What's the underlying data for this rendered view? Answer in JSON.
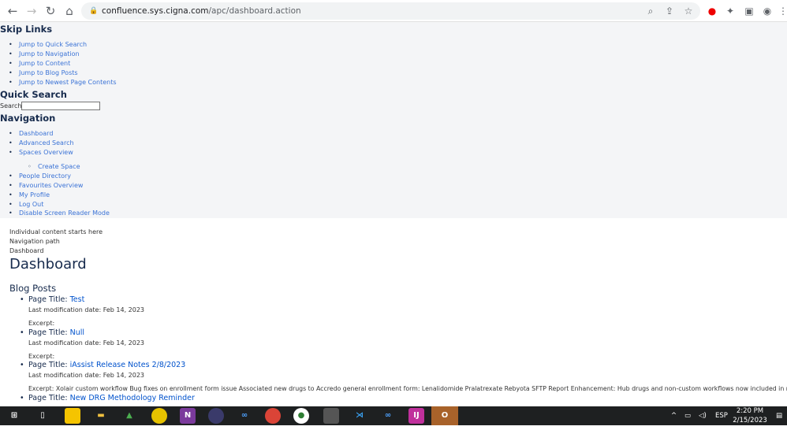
{
  "browser": {
    "url_host": "confluence.sys.cigna.com",
    "url_path": "/apc/dashboard.action"
  },
  "skip_links": {
    "heading": "Skip Links",
    "items": [
      "Jump to Quick Search",
      "Jump to Navigation",
      "Jump to Content",
      "Jump to Blog Posts",
      "Jump to Newest Page Contents"
    ]
  },
  "quick_search": {
    "heading": "Quick Search",
    "label": "Search",
    "value": ""
  },
  "navigation": {
    "heading": "Navigation",
    "items": [
      "Dashboard",
      "Advanced Search",
      "Spaces Overview"
    ],
    "sub_items": [
      "Create Space"
    ],
    "items2": [
      "People Directory",
      "Favourites Overview",
      "My Profile",
      "Log Out",
      "Disable Screen Reader Mode"
    ]
  },
  "content": {
    "start_note": "Individual content starts here",
    "nav_path_label": "Navigation path",
    "breadcrumb": "Dashboard",
    "title": "Dashboard"
  },
  "blog": {
    "heading": "Blog Posts",
    "title_label": "Page Title:",
    "date_label": "Last modification date:",
    "excerpt_label": "Excerpt:",
    "posts": [
      {
        "title": "Test",
        "date": "Feb 14, 2023",
        "excerpt": ""
      },
      {
        "title": "Null",
        "date": "Feb 14, 2023",
        "excerpt": ""
      },
      {
        "title": "iAssist Release Notes 2/8/2023",
        "date": "Feb 14, 2023",
        "excerpt": "Xolair custom workflow Bug fixes on enrollment form issue Associated new drugs to Accredo general enrollment form: Lenalidomide Pralatrexate Rebyota SFTP Report Enhancement: Hub drugs and non-custom workflows now included in report"
      },
      {
        "title": "New DRG Methodology Reminder"
      }
    ]
  },
  "taskbar": {
    "lang": "ESP",
    "time": "2:20 PM",
    "date": "2/15/2023"
  }
}
